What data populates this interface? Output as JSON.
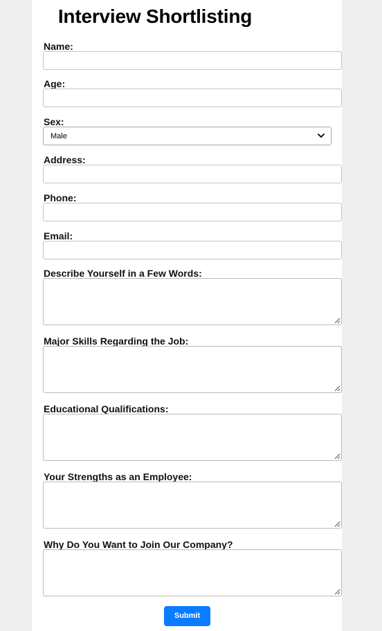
{
  "form": {
    "title": "Interview Shortlisting",
    "fields": {
      "name": {
        "label": "Name:",
        "value": ""
      },
      "age": {
        "label": "Age:",
        "value": ""
      },
      "sex": {
        "label": "Sex:",
        "selected": "Male"
      },
      "address": {
        "label": "Address:",
        "value": ""
      },
      "phone": {
        "label": "Phone:",
        "value": ""
      },
      "email": {
        "label": "Email:",
        "value": ""
      },
      "describe": {
        "label": "Describe Yourself in a Few Words:",
        "value": ""
      },
      "skills": {
        "label": "Major Skills Regarding the Job:",
        "value": ""
      },
      "education": {
        "label": "Educational Qualifications:",
        "value": ""
      },
      "strengths": {
        "label": "Your Strengths as an Employee:",
        "value": ""
      },
      "why": {
        "label": "Why Do You Want to Join Our Company?",
        "value": ""
      }
    },
    "submit_label": "Submit"
  },
  "colors": {
    "page_background": "#efefef",
    "card_background": "#ffffff",
    "submit_button": "#0a7cff",
    "border": "#c4c4c4"
  },
  "icons": {
    "select_arrow": "chevron-down-icon",
    "resize_handle": "resize-grip-icon"
  }
}
